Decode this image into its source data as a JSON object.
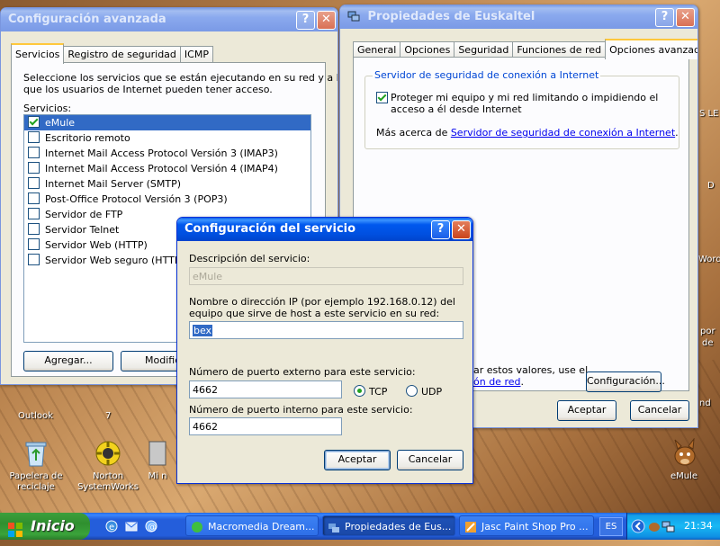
{
  "desktop": {
    "icons": [
      {
        "label": "Papelera de reciclaje"
      },
      {
        "label": "Norton SystemWorks"
      },
      {
        "label": "Mi n"
      },
      {
        "label": "eMule"
      }
    ],
    "partial_labels": {
      "outlook": "Outlook",
      "seven": "7",
      "s_le": "S LE",
      "d": "D",
      "word": "Word",
      "por": "por",
      "de": "de",
      "nd": "nd"
    }
  },
  "win_advanced": {
    "title": "Configuración avanzada",
    "help": "?",
    "close": "✕",
    "tabs": [
      "Servicios",
      "Registro de seguridad",
      "ICMP"
    ],
    "description": [
      "Seleccione los servicios que se están ejecutando en su red y a los",
      "que los usuarios de Internet pueden tener acceso."
    ],
    "services_label": "Servicios:",
    "services": [
      {
        "label": "eMule",
        "checked": true,
        "selected": true
      },
      {
        "label": "Escritorio remoto",
        "checked": false
      },
      {
        "label": "Internet Mail Access Protocol Versión 3 (IMAP3)",
        "checked": false
      },
      {
        "label": "Internet Mail Access Protocol Versión 4 (IMAP4)",
        "checked": false
      },
      {
        "label": "Internet Mail Server (SMTP)",
        "checked": false
      },
      {
        "label": "Post-Office Protocol Versión 3 (POP3)",
        "checked": false
      },
      {
        "label": "Servidor de FTP",
        "checked": false
      },
      {
        "label": "Servidor Telnet",
        "checked": false
      },
      {
        "label": "Servidor Web (HTTP)",
        "checked": false
      },
      {
        "label": "Servidor Web seguro (HTTPS)",
        "checked": false
      }
    ],
    "add_button": "Agregar...",
    "modify_button": "Modifica"
  },
  "win_props": {
    "title": "Propiedades de Euskaltel",
    "help": "?",
    "close": "✕",
    "tabs": [
      "General",
      "Opciones",
      "Seguridad",
      "Funciones de red",
      "Opciones avanzadas"
    ],
    "group_title": "Servidor de seguridad de conexión a Internet",
    "protect_label": [
      "Proteger mi equipo y mi red limitando o impidiendo el",
      "acceso a él desde Internet"
    ],
    "protect_checked": true,
    "more_prefix": "Más acerca de ",
    "more_link": "Servidor de seguridad de conexión a Internet",
    "more_suffix": ".",
    "partial_text1": "ar estos valores, use el",
    "partial_link": "ón de red",
    "partial_suffix": ".",
    "config_button": "Configuración...",
    "ok_button": "Aceptar",
    "cancel_button": "Cancelar"
  },
  "win_service": {
    "title": "Configuración del servicio",
    "help": "?",
    "close": "✕",
    "desc_label": "Descripción del servicio:",
    "desc_value": "eMule",
    "host_label": [
      "Nombre o dirección IP (por ejemplo 192.168.0.12) del",
      "equipo que sirve de host a este servicio en su red:"
    ],
    "host_value": "bex",
    "ext_port_label": "Número de puerto externo para este servicio:",
    "ext_port_value": "4662",
    "tcp_label": "TCP",
    "udp_label": "UDP",
    "protocol_selected": "TCP",
    "int_port_label": "Número de puerto interno para este servicio:",
    "int_port_value": "4662",
    "ok_button": "Aceptar",
    "cancel_button": "Cancelar"
  },
  "taskbar": {
    "start_label": "Inicio",
    "tasks": [
      {
        "label": "Macromedia Dream..."
      },
      {
        "label": "Propiedades de Eus..."
      },
      {
        "label": "Jasc Paint Shop Pro ..."
      }
    ],
    "language": "ES",
    "clock": "21:34"
  },
  "colors": {
    "xp_blue": "#0054e3",
    "start_green": "#3c9f3c",
    "selection": "#316ac5",
    "link": "#0000ee"
  }
}
